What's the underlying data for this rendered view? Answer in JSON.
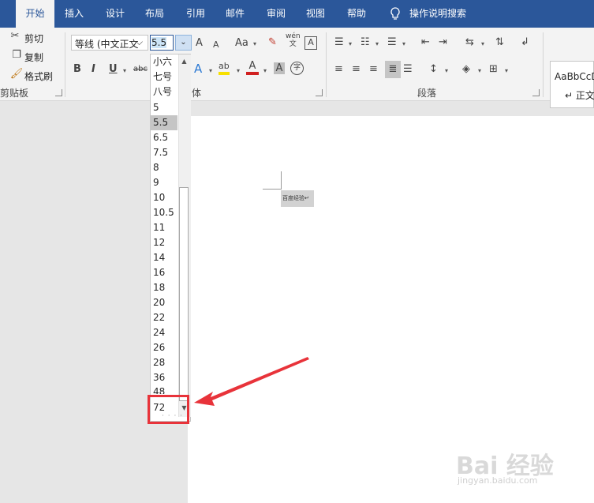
{
  "tabs": [
    {
      "label": "开始",
      "active": true
    },
    {
      "label": "插入"
    },
    {
      "label": "设计"
    },
    {
      "label": "布局"
    },
    {
      "label": "引用"
    },
    {
      "label": "邮件"
    },
    {
      "label": "审阅"
    },
    {
      "label": "视图"
    },
    {
      "label": "帮助"
    }
  ],
  "tell_me": "操作说明搜索",
  "clipboard": {
    "cut": "剪切",
    "copy": "复制",
    "format_painter": "格式刷",
    "label": "剪贴板"
  },
  "font": {
    "name": "等线 (中文正文",
    "size": "5.5",
    "grow": "A",
    "shrink": "A",
    "case": "Aa",
    "phonetic": "wén\n文",
    "border_char": "A",
    "bold": "B",
    "italic": "I",
    "underline": "U",
    "strike": "abc",
    "effects": "A",
    "highlight": "ab",
    "color": "A",
    "shading": "A",
    "enclose": "字",
    "label": "体"
  },
  "paragraph": {
    "label": "段落"
  },
  "styles": {
    "sample": "AaBbCcD",
    "normal": "↵ 正文"
  },
  "size_list": {
    "options": [
      "小六",
      "七号",
      "八号",
      "5",
      "5.5",
      "6.5",
      "7.5",
      "8",
      "9",
      "10",
      "10.5",
      "11",
      "12",
      "14",
      "16",
      "18",
      "20",
      "22",
      "24",
      "26",
      "28",
      "36",
      "48",
      "72"
    ],
    "selected": "5.5"
  },
  "document": {
    "selected_text": "百度经验↵"
  },
  "watermark": {
    "brand": "Bai 经验",
    "url": "jingyan.baidu.com"
  },
  "colors": {
    "tab_bar": "#2b579a",
    "highlight_box": "#e8333a"
  }
}
